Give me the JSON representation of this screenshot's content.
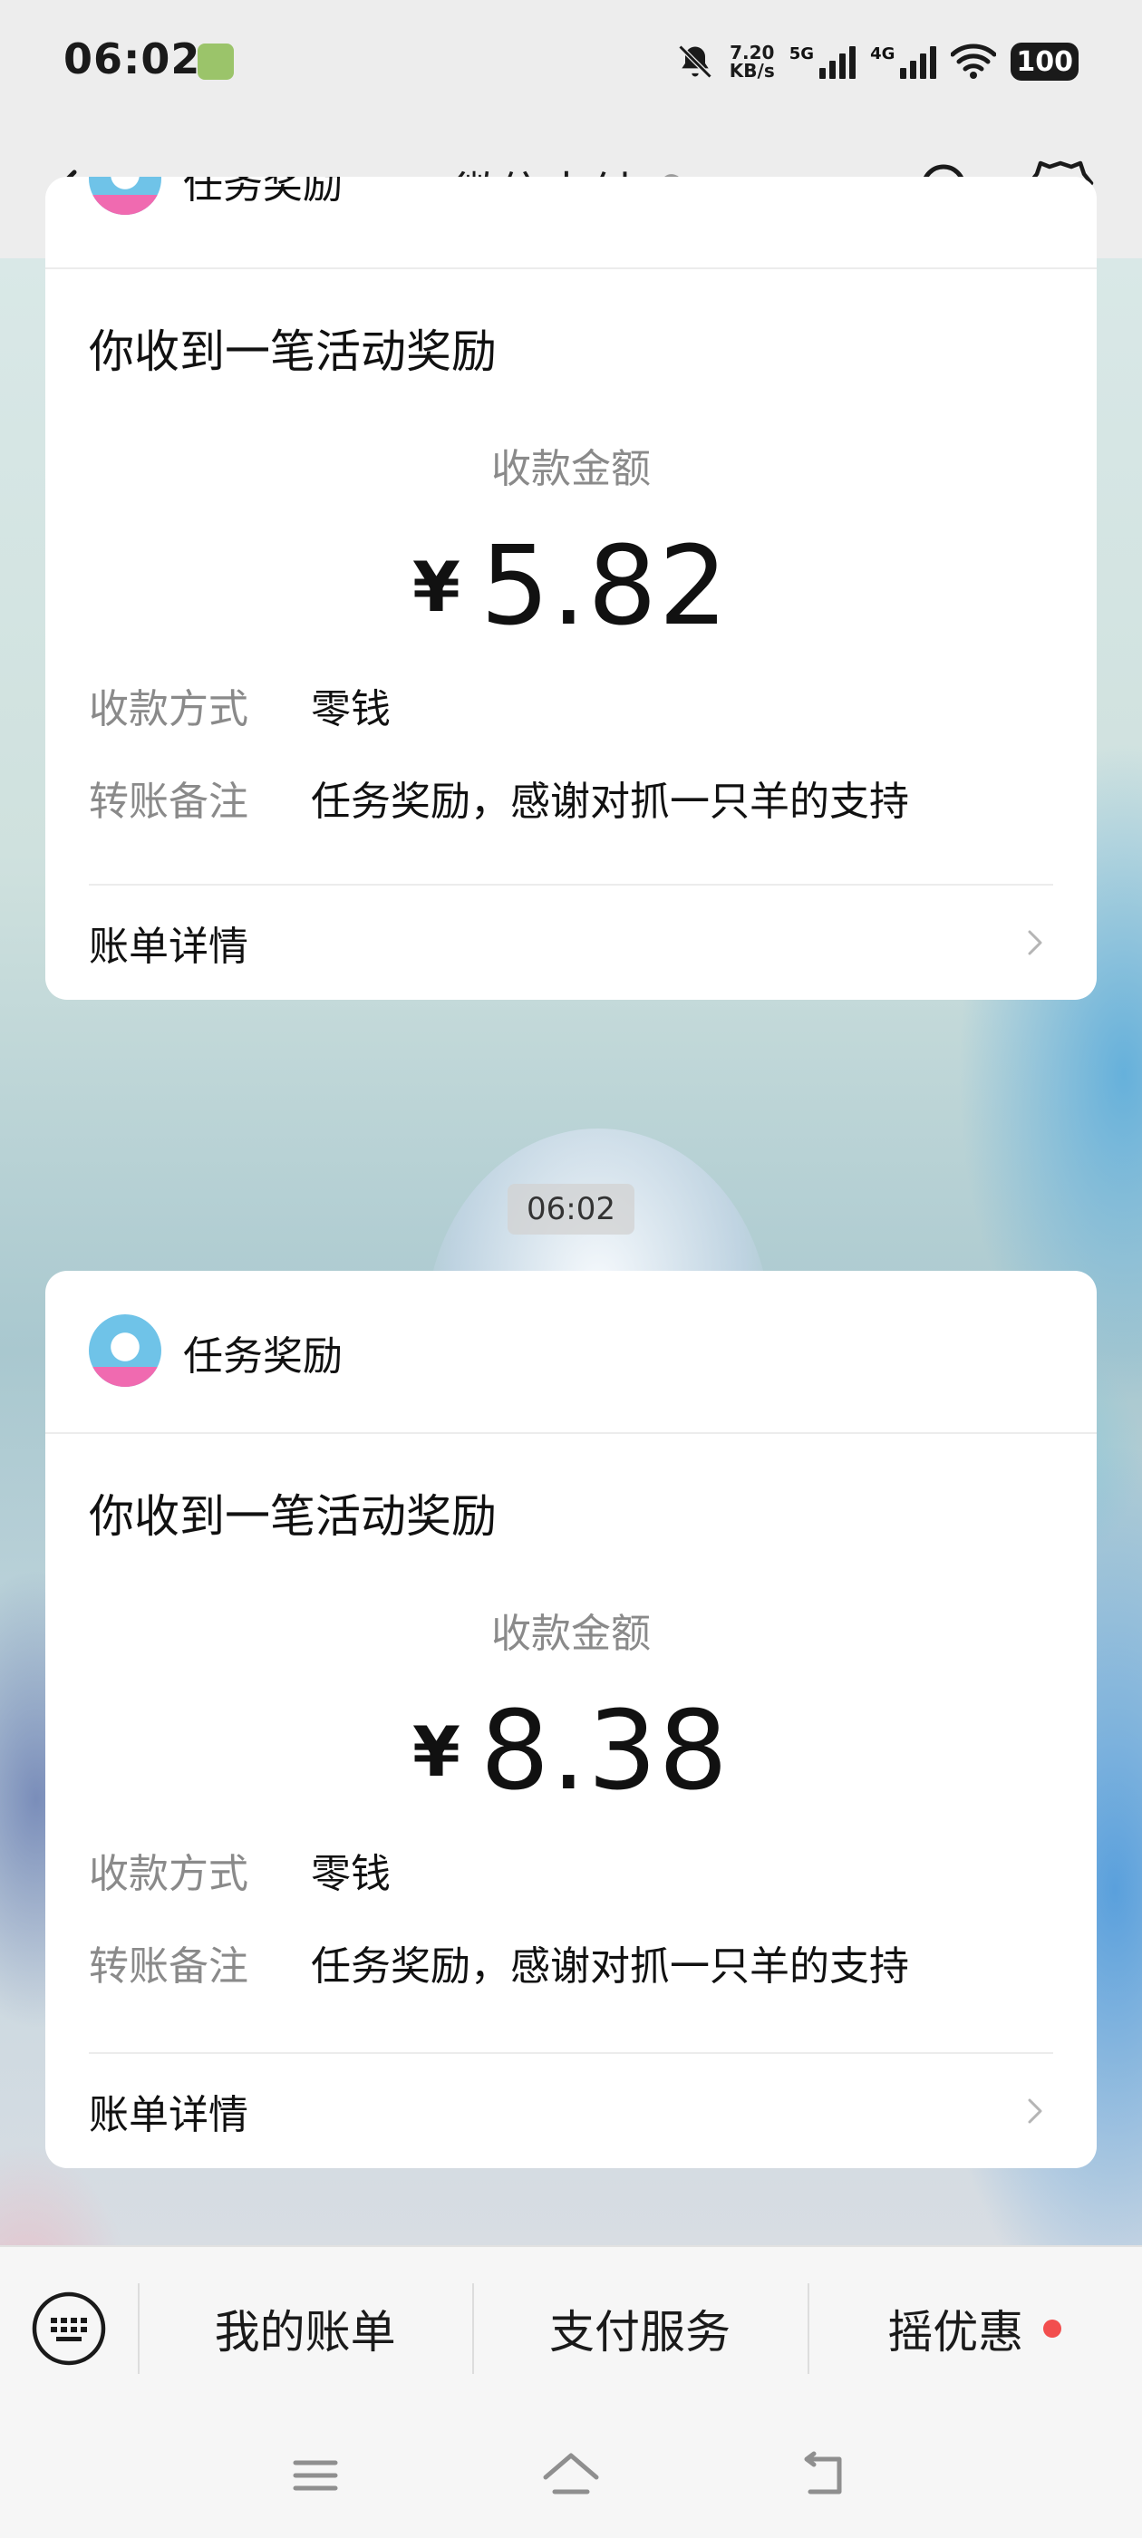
{
  "status_bar": {
    "time": "06:02",
    "net_speed_value": "7.20",
    "net_speed_unit": "KB/s",
    "net1_label": "5G",
    "net2_label": "4G",
    "battery": "100"
  },
  "header": {
    "title": "微信支付"
  },
  "messages": [
    {
      "sender": "任务奖励",
      "subject": "你收到一笔活动奖励",
      "amount_label": "收款金额",
      "currency": "¥",
      "amount": "5.82",
      "rows": [
        {
          "key": "收款方式",
          "value": "零钱"
        },
        {
          "key": "转账备注",
          "value": "任务奖励，感谢对抓一只羊的支持"
        }
      ],
      "detail_link": "账单详情"
    },
    {
      "sender": "任务奖励",
      "subject": "你收到一笔活动奖励",
      "amount_label": "收款金额",
      "currency": "¥",
      "amount": "8.38",
      "rows": [
        {
          "key": "收款方式",
          "value": "零钱"
        },
        {
          "key": "转账备注",
          "value": "任务奖励，感谢对抓一只羊的支持"
        }
      ],
      "detail_link": "账单详情"
    }
  ],
  "timestamp": "06:02",
  "bottom_menu": {
    "items": [
      "我的账单",
      "支付服务",
      "摇优惠"
    ]
  },
  "colors": {
    "page_bg": "#ededed",
    "card_bg": "#ffffff",
    "secondary_text": "#8a8a8a",
    "badge_red": "#f24e4e"
  },
  "icons": {
    "back": "chevron-left-icon",
    "ear": "ear-icon",
    "search": "search-icon",
    "settings": "gear-icon",
    "keyboard": "keyboard-icon",
    "chevron": "chevron-right-icon",
    "menu": "menu-icon",
    "home": "home-icon",
    "back_nav": "back-icon"
  }
}
